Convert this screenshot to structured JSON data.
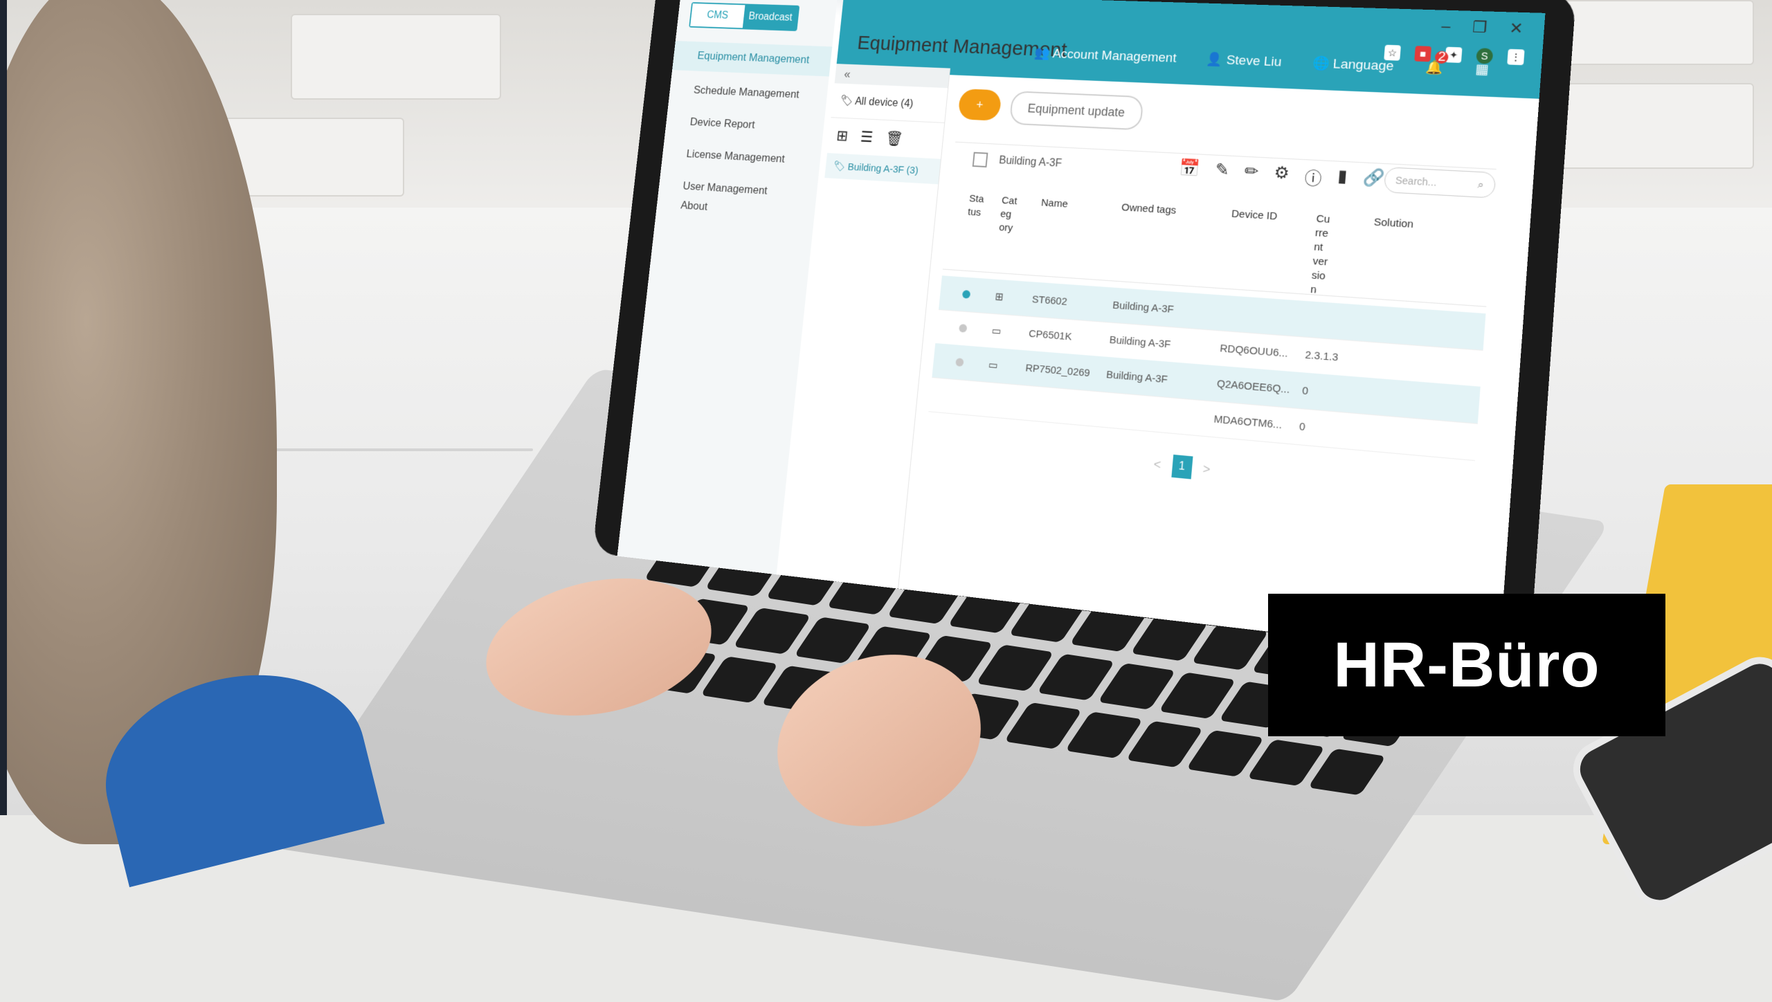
{
  "browser": {
    "window_controls": [
      "–",
      "❐",
      "✕"
    ],
    "profile_initial": "S"
  },
  "app": {
    "page_title": "Equipment Management",
    "top_nav": {
      "account": "Account Management",
      "user": "Steve Liu",
      "language": "Language",
      "notifications": "2"
    },
    "mode_tabs": {
      "cms": "CMS",
      "broadcast": "Broadcast",
      "active": "Broadcast"
    },
    "sidebar": [
      "Equipment Management",
      "Schedule Management",
      "Device Report",
      "License Management",
      "User Management",
      "About"
    ],
    "tags": {
      "collapse": "«",
      "all": "All device (4)",
      "selected": "Building A-3F (3)"
    },
    "toolbar": {
      "add": "+",
      "update": "Equipment update",
      "group_label": "Building A-3F",
      "search_placeholder": "Search..."
    },
    "table": {
      "headers": {
        "status": "Sta\ntus",
        "category": "Cat\neg\nory",
        "name": "Name",
        "owned_tags": "Owned tags",
        "device_id": "Device ID",
        "current_version": "Cu\nrre\nnt\nver\nsio\nn",
        "solution": "Solution"
      },
      "rows": [
        {
          "status": "online",
          "category": "windows",
          "name": "ST6602",
          "tags": "Building A-3F",
          "device_id": "",
          "version": ""
        },
        {
          "status": "offline",
          "category": "display",
          "name": "CP6501K",
          "tags": "Building A-3F",
          "device_id": "RDQ6OUU6...",
          "version": "2.3.1.3"
        },
        {
          "status": "offline",
          "category": "display",
          "name": "RP7502_0269",
          "tags": "Building A-3F",
          "device_id": "Q2A6OEE6Q...",
          "version": "0"
        },
        {
          "status": "none",
          "category": "",
          "name": "",
          "tags": "",
          "device_id": "MDA6OTM6...",
          "version": "0"
        }
      ],
      "page": "1",
      "prev": "<",
      "next": ">"
    }
  },
  "overlay": {
    "label": "HR-Büro"
  },
  "colors": {
    "accent": "#2aa3b8",
    "add_button": "#f39c12",
    "badge": "#e53935",
    "overlay_bg": "#000000"
  }
}
